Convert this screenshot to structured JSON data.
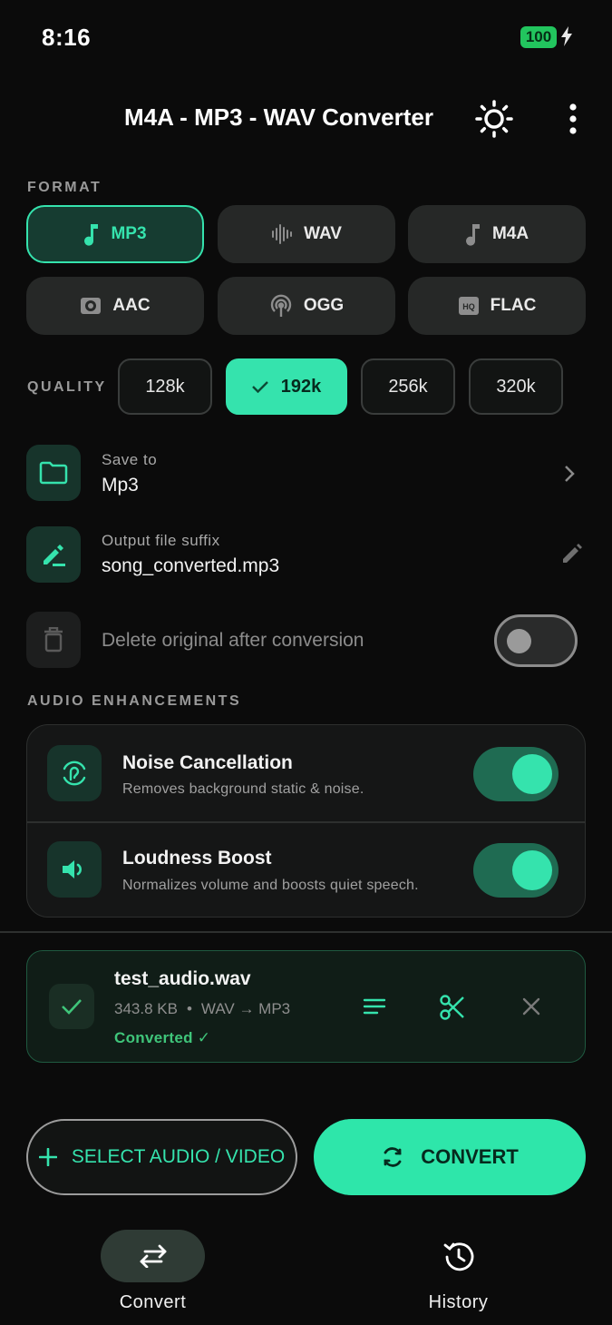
{
  "status_bar": {
    "time": "8:16",
    "battery": "100"
  },
  "header": {
    "title": "M4A - MP3 - WAV Converter",
    "theme_icon": "sun-icon",
    "menu_icon": "more-vertical-icon"
  },
  "format": {
    "label": "FORMAT",
    "options": [
      {
        "label": "MP3",
        "icon": "music-note-icon",
        "selected": true
      },
      {
        "label": "WAV",
        "icon": "waveform-icon",
        "selected": false
      },
      {
        "label": "M4A",
        "icon": "music-note-icon",
        "selected": false
      },
      {
        "label": "AAC",
        "icon": "speaker-box-icon",
        "selected": false
      },
      {
        "label": "OGG",
        "icon": "broadcast-icon",
        "selected": false
      },
      {
        "label": "FLAC",
        "icon": "hq-icon",
        "selected": false
      }
    ]
  },
  "quality": {
    "label": "QUALITY",
    "options": [
      {
        "label": "128k",
        "selected": false
      },
      {
        "label": "192k",
        "selected": true
      },
      {
        "label": "256k",
        "selected": false
      },
      {
        "label": "320k",
        "selected": false
      }
    ]
  },
  "save_to": {
    "label": "Save to",
    "value": "Mp3"
  },
  "suffix": {
    "label": "Output file suffix",
    "value": "song_converted.mp3"
  },
  "delete_original": {
    "label": "Delete original after conversion",
    "enabled": false
  },
  "enhancements": {
    "label": "AUDIO ENHANCEMENTS",
    "items": [
      {
        "title": "Noise Cancellation",
        "desc": "Removes background static & noise.",
        "enabled": true
      },
      {
        "title": "Loudness Boost",
        "desc": "Normalizes volume and boosts quiet speech.",
        "enabled": true
      }
    ]
  },
  "file": {
    "name": "test_audio.wav",
    "size": "343.8 KB",
    "sep": "•",
    "conversion": "WAV → MP3",
    "status": "Converted ✓"
  },
  "actions": {
    "select_label": "SELECT AUDIO / VIDEO",
    "convert_label": "CONVERT"
  },
  "nav": {
    "convert_label": "Convert",
    "history_label": "History"
  },
  "colors": {
    "accent": "#35e3ad",
    "background": "#0b0b0b",
    "success": "#3fc57a"
  }
}
